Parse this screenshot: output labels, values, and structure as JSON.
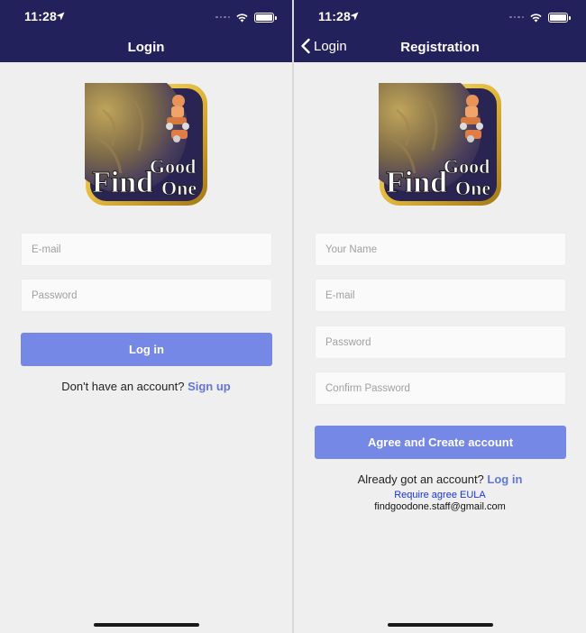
{
  "status_bar": {
    "time": "11:28"
  },
  "login_screen": {
    "title": "Login",
    "email_placeholder": "E-mail",
    "password_placeholder": "Password",
    "login_button": "Log in",
    "signup_prompt": "Don't have an account?",
    "signup_link": "Sign up"
  },
  "registration_screen": {
    "back_label": "Login",
    "title": "Registration",
    "name_placeholder": "Your Name",
    "email_placeholder": "E-mail",
    "password_placeholder": "Password",
    "confirm_placeholder": "Confirm Password",
    "create_button": "Agree and Create account",
    "login_prompt": "Already got an account?",
    "login_link": "Log in",
    "eula_link": "Require agree EULA",
    "contact_email": "findgoodone.staff@gmail.com"
  },
  "logo": {
    "word_find": "Find",
    "word_good": "Good",
    "word_one": "One"
  },
  "colors": {
    "nav_bg": "#23215b",
    "button": "#7688e6",
    "link": "#6176d8",
    "eula": "#1a35d6",
    "background": "#efefef"
  },
  "icons": [
    "location-arrow-icon",
    "signal-icon",
    "wifi-icon",
    "battery-icon",
    "back-chevron-icon"
  ]
}
